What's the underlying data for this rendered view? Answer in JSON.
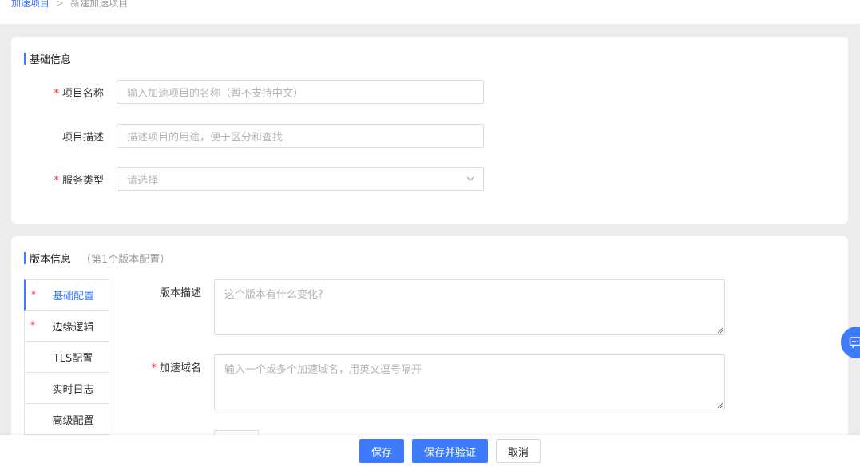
{
  "breadcrumb": {
    "parent": "加速项目",
    "separator": ">",
    "current": "新建加速项目"
  },
  "basic_section": {
    "title": "基础信息",
    "fields": [
      {
        "label": "项目名称",
        "required": true,
        "placeholder": "输入加速项目的名称（暂不支持中文）"
      },
      {
        "label": "项目描述",
        "required": false,
        "placeholder": "描述项目的用途，便于区分和查找"
      },
      {
        "label": "服务类型",
        "required": true,
        "placeholder": "请选择",
        "type": "select"
      }
    ]
  },
  "version_section": {
    "title": "版本信息",
    "subtitle": "（第1个版本配置）",
    "tabs": [
      {
        "label": "基础配置",
        "required": true,
        "active": true
      },
      {
        "label": "边缘逻辑",
        "required": true,
        "active": false
      },
      {
        "label": "TLS配置",
        "required": false,
        "active": false
      },
      {
        "label": "实时日志",
        "required": false,
        "active": false
      },
      {
        "label": "高级配置",
        "required": false,
        "active": false
      }
    ],
    "fields": [
      {
        "label": "版本描述",
        "required": false,
        "placeholder": "这个版本有什么变化?"
      },
      {
        "label": "加速域名",
        "required": true,
        "placeholder": "输入一个或多个加速域名，用英文逗号隔开"
      }
    ]
  },
  "actions": {
    "save": "保存",
    "save_verify": "保存并验证",
    "cancel": "取消"
  },
  "required_mark": "*",
  "colors": {
    "accent": "#3d7bfd",
    "required": "#f5222d",
    "page_bg": "#ececec"
  },
  "icons": {
    "select_arrow": "chevron-down-icon",
    "floating": "chat-icon"
  }
}
